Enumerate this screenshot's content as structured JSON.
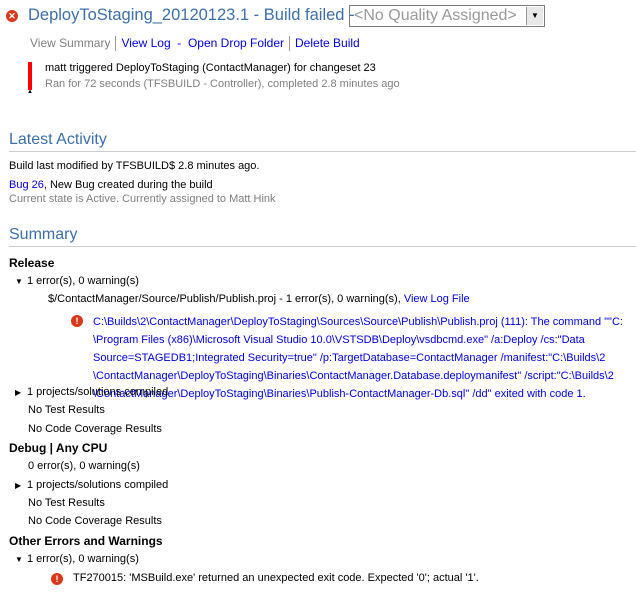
{
  "header": {
    "title": "DeployToStaging_20120123.1 - Build failed -",
    "quality": "<No Quality Assigned>",
    "links": {
      "view_summary": "View Summary",
      "view_log": "View Log",
      "dash": "-",
      "open_drop": "Open Drop Folder",
      "delete": "Delete Build"
    },
    "trigger": "matt triggered DeployToStaging (ContactManager) for changeset 23",
    "ran": "Ran for 72 seconds (TFSBUILD - Controller), completed 2.8 minutes ago"
  },
  "activity": {
    "heading": "Latest Activity",
    "modified": "Build last modified by TFSBUILD$ 2.8 minutes ago.",
    "bug_link": "Bug 26",
    "bug_text": ", New Bug created during the build",
    "state": "Current state is Active. Currently assigned to Matt Hink"
  },
  "summary": {
    "heading": "Summary",
    "release": {
      "title": "Release",
      "errors": "1 error(s), 0 warning(s)",
      "proj": "$/ContactManager/Source/Publish/Publish.proj - 1 error(s), 0 warning(s),",
      "view_log_file": "View Log File",
      "error_lines": [
        "C:\\Builds\\2\\ContactManager\\DeployToStaging\\Sources\\Source\\Publish\\Publish.proj (111): The command \"\"C:",
        "\\Program Files (x86)\\Microsoft Visual Studio 10.0\\VSTSDB\\Deploy\\vsdbcmd.exe\" /a:Deploy /cs:\"Data",
        "Source=STAGEDB1;Integrated Security=true\" /p:TargetDatabase=ContactManager /manifest:\"C:\\Builds\\2",
        "\\ContactManager\\DeployToStaging\\Binaries\\ContactManager.Database.deploymanifest\" /script:\"C:\\Builds\\2",
        "\\ContactManager\\DeployToStaging\\Binaries\\Publish-ContactManager-Db.sql\" /dd\" exited with code 1."
      ],
      "compiled": "1 projects/solutions compiled",
      "tests": "No Test Results",
      "coverage": "No Code Coverage Results"
    },
    "debug": {
      "title": "Debug | Any CPU",
      "errors": "0 error(s), 0 warning(s)",
      "compiled": "1 projects/solutions compiled",
      "tests": "No Test Results",
      "coverage": "No Code Coverage Results"
    },
    "other": {
      "title": "Other Errors and Warnings",
      "errors": "1 error(s), 0 warning(s)",
      "message": "TF270015: 'MSBuild.exe' returned an unexpected exit code. Expected '0'; actual '1'."
    }
  }
}
